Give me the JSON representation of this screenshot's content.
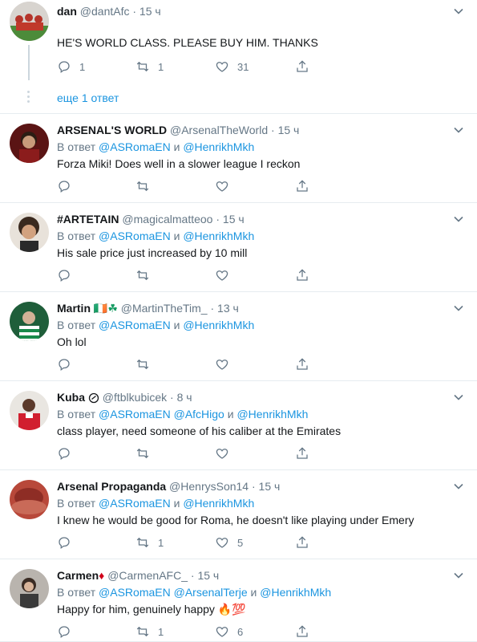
{
  "thread": {
    "more_replies_label": "еще 1 ответ"
  },
  "tweets": [
    {
      "name": "dan",
      "handle": "@dantAfc",
      "dot": "·",
      "time": "15 ч",
      "reply_prefix": "",
      "mentions": [],
      "text": "HE'S WORLD CLASS. PLEASE BUY HIM. THANKS",
      "reply_count": "1",
      "retweet_count": "1",
      "like_count": "31",
      "avatar_color": "#b5342a"
    },
    {
      "name": "ARSENAL'S WORLD",
      "handle": "@ArsenalTheWorld",
      "dot": "·",
      "time": "15 ч",
      "reply_prefix": "В ответ",
      "mentions": [
        "@ASRomaEN",
        "@HenrikhMkh"
      ],
      "joiners": [
        "и"
      ],
      "text": "Forza Miki! Does well in a slower league I reckon",
      "reply_count": "",
      "retweet_count": "",
      "like_count": "",
      "avatar_color": "#6b1a1a"
    },
    {
      "name": "#ARTETAIN",
      "handle": "@magicalmatteoo",
      "dot": "·",
      "time": "15 ч",
      "reply_prefix": "В ответ",
      "mentions": [
        "@ASRomaEN",
        "@HenrikhMkh"
      ],
      "joiners": [
        "и"
      ],
      "text": "His sale price just increased by 10 mill",
      "reply_count": "",
      "retweet_count": "",
      "like_count": "",
      "avatar_color": "#c9a07e"
    },
    {
      "name": "Martin",
      "name_emoji": "🇮🇪☘",
      "handle": "@MartinTheTim_",
      "dot": "·",
      "time": "13 ч",
      "reply_prefix": "В ответ",
      "mentions": [
        "@ASRomaEN",
        "@HenrikhMkh"
      ],
      "joiners": [
        "и"
      ],
      "text": "Oh lol",
      "reply_count": "",
      "retweet_count": "",
      "like_count": "",
      "avatar_color": "#2e7d4f"
    },
    {
      "name": "Kuba",
      "handle": "@ftblkubicek",
      "dot": "·",
      "time": "8 ч",
      "reply_prefix": "В ответ",
      "mentions": [
        "@ASRomaEN",
        "@AfcHigo",
        "@HenrikhMkh"
      ],
      "joiners": [
        "",
        "и"
      ],
      "text": "class player, need someone of his caliber at the Emirates",
      "reply_count": "",
      "retweet_count": "",
      "like_count": "",
      "avatar_color": "#c8102e"
    },
    {
      "name": "Arsenal Propaganda",
      "handle": "@HenrysSon14",
      "dot": "·",
      "time": "15 ч",
      "reply_prefix": "В ответ",
      "mentions": [
        "@ASRomaEN",
        "@HenrikhMkh"
      ],
      "joiners": [
        "и"
      ],
      "text": "I knew he would be good for Roma, he doesn't like playing under Emery",
      "reply_count": "",
      "retweet_count": "1",
      "like_count": "5",
      "avatar_color": "#a33b2e"
    },
    {
      "name": "Carmen",
      "name_emoji": "♦",
      "handle": "@CarmenAFC_",
      "dot": "·",
      "time": "15 ч",
      "reply_prefix": "В ответ",
      "mentions": [
        "@ASRomaEN",
        "@ArsenalTerje",
        "@HenrikhMkh"
      ],
      "joiners": [
        "",
        "и"
      ],
      "text": "Happy for him, genuinely happy",
      "text_emoji": "🔥💯",
      "reply_count": "",
      "retweet_count": "1",
      "like_count": "6",
      "avatar_color": "#8a8f94"
    }
  ],
  "colors": {
    "link": "#1b95e0",
    "muted": "#657786",
    "text": "#14171a",
    "divider": "#e6ecf0"
  },
  "icons": [
    "reply-icon",
    "retweet-icon",
    "like-icon",
    "share-icon",
    "chevron-down-icon",
    "verified-icon"
  ]
}
